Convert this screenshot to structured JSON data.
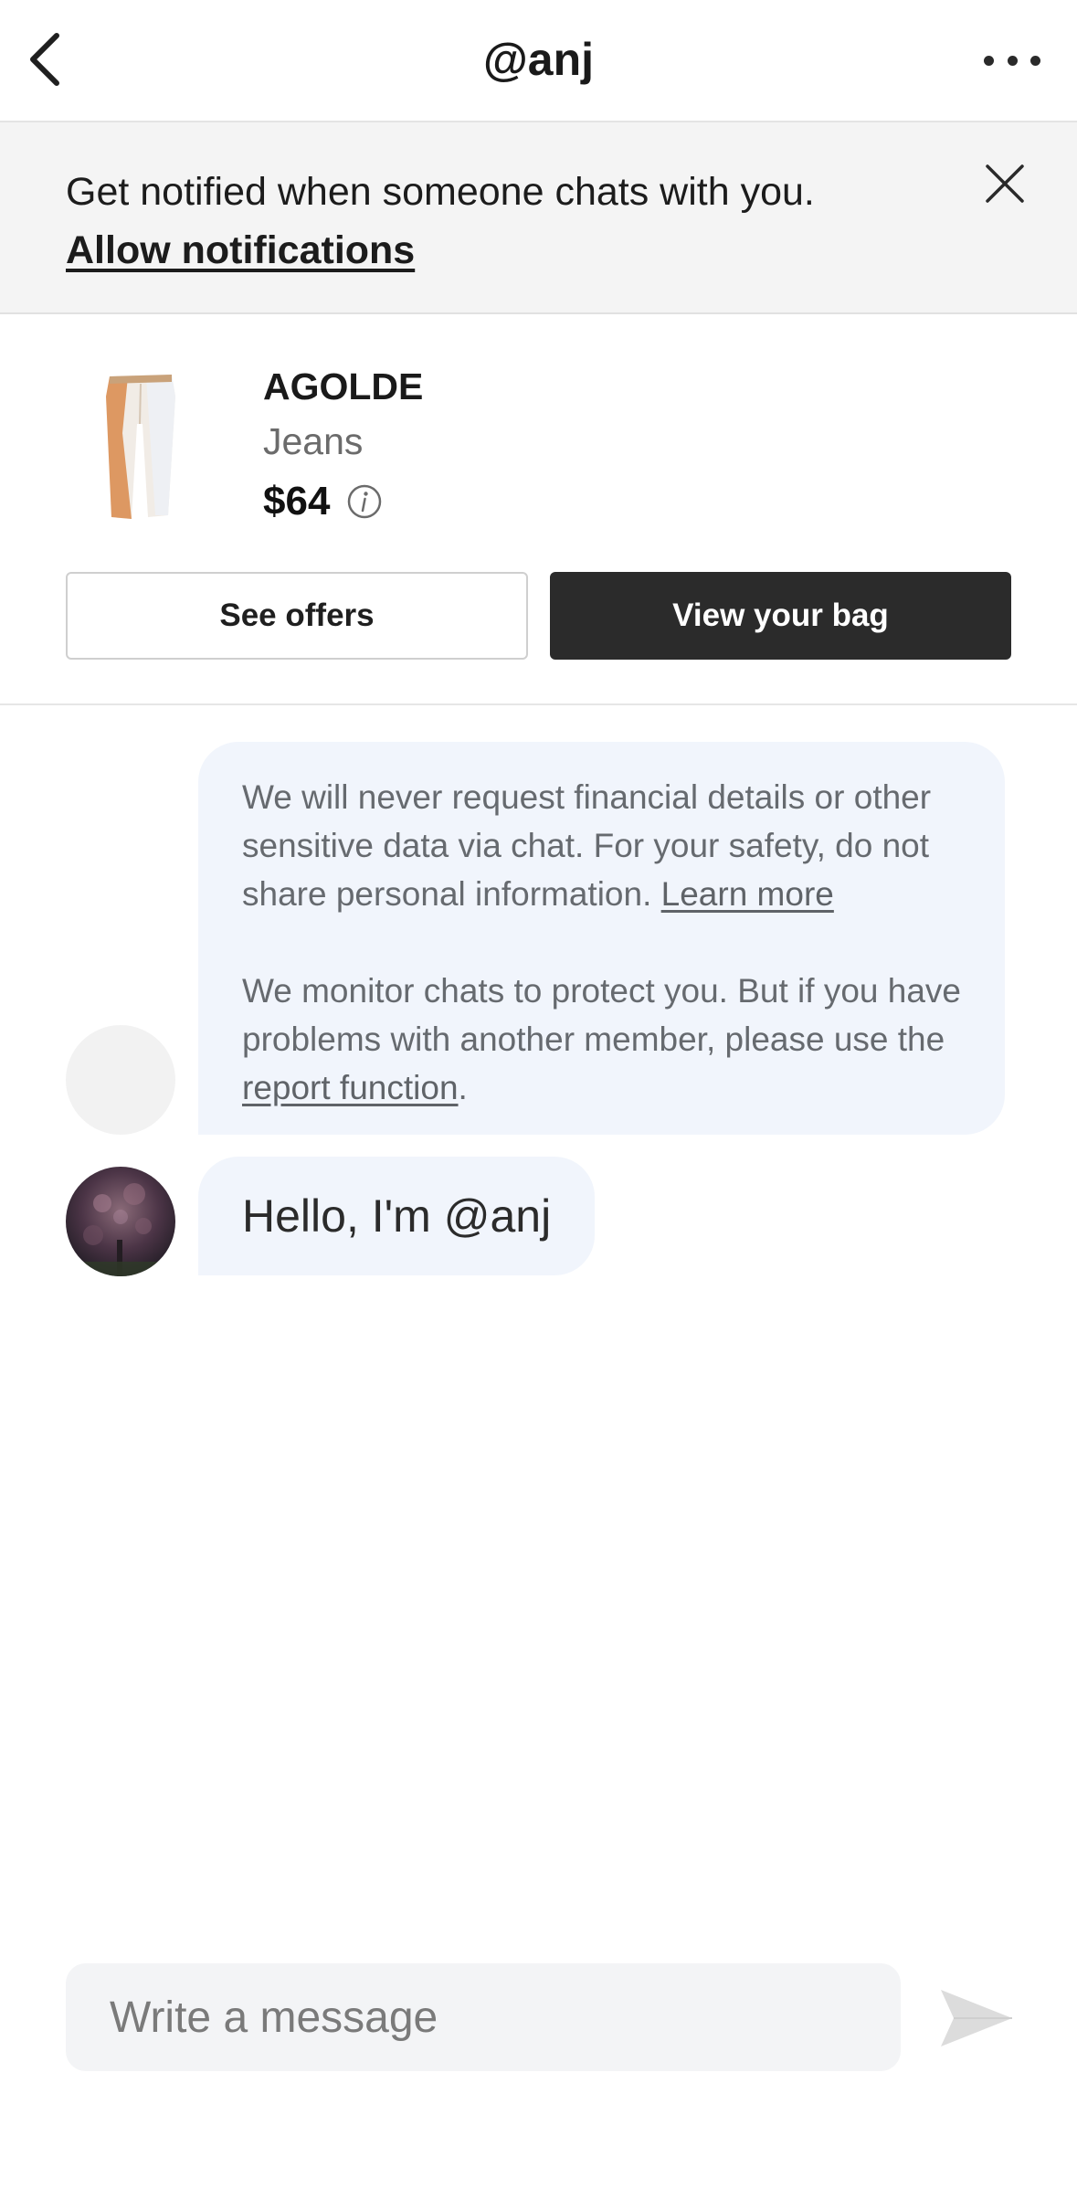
{
  "header": {
    "title": "@anj"
  },
  "notification_banner": {
    "text": "Get notified when someone chats with you.",
    "link": "Allow notifications"
  },
  "product": {
    "brand": "AGOLDE",
    "category": "Jeans",
    "price": "$64",
    "see_offers_label": "See offers",
    "view_bag_label": "View your bag"
  },
  "chat": {
    "safety_text_1": "We will never request financial details or other sensitive data via chat. For your safety, do not share personal information. ",
    "safety_link_1": "Learn more",
    "safety_text_2": "We monitor chats to protect you. But if you have problems with another member, please use the ",
    "safety_link_2": "report function",
    "safety_text_2_end": ".",
    "greeting": "Hello, I'm @anj"
  },
  "composer": {
    "placeholder": "Write a message"
  },
  "icons": {
    "back": "chevron-left-icon",
    "more": "more-horizontal-icon",
    "close": "close-icon",
    "info": "info-icon",
    "send": "send-icon"
  },
  "colors": {
    "bubble_bg": "#f1f5fc",
    "primary_button": "#2b2b2b",
    "banner_bg": "#f4f4f4"
  }
}
